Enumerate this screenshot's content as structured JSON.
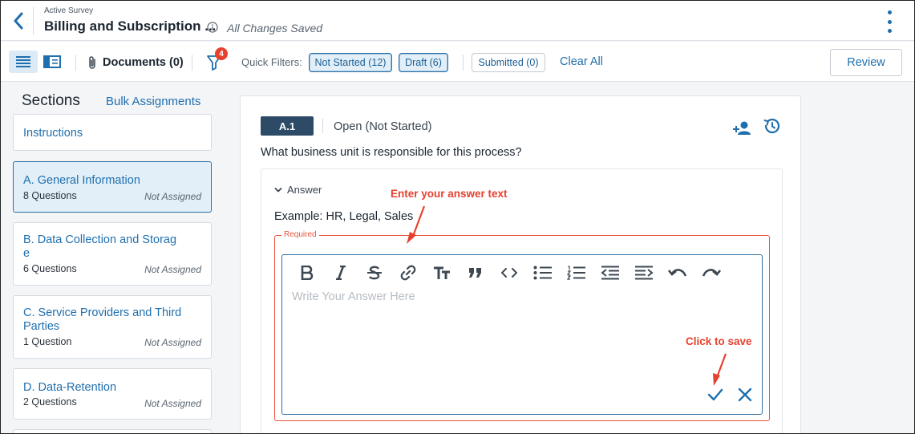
{
  "header": {
    "kicker": "Active Survey",
    "title": "Billing and Subscription ...",
    "save_status": "All Changes Saved"
  },
  "toolbar": {
    "documents_label": "Documents (0)",
    "filter_count": "4",
    "quick_filters_label": "Quick Filters:",
    "chips": [
      {
        "label": "Not Started (12)",
        "active": true
      },
      {
        "label": "Draft (6)",
        "active": true
      },
      {
        "label": "Submitted (0)",
        "active": false
      }
    ],
    "clear_all": "Clear All",
    "review": "Review"
  },
  "sidebar": {
    "title": "Sections",
    "bulk_link": "Bulk Assignments",
    "instructions": "Instructions",
    "sections": [
      {
        "name": "A. General Information",
        "count": "8 Questions",
        "assign": "Not Assigned",
        "selected": true
      },
      {
        "name": "B. Data Collection and Storag\ne",
        "count": "6 Questions",
        "assign": "Not Assigned",
        "selected": false
      },
      {
        "name": "C. Service Providers and Third\nParties",
        "count": "1 Question",
        "assign": "Not Assigned",
        "selected": false
      },
      {
        "name": "D. Data-Retention",
        "count": "2 Questions",
        "assign": "Not Assigned",
        "selected": false
      }
    ]
  },
  "question": {
    "id": "A.1",
    "status": "Open (Not Started)",
    "text": "What business unit is responsible for this process?",
    "answer_label": "Answer",
    "example": "Example: HR, Legal, Sales",
    "required_label": "Required",
    "placeholder": "Write Your Answer Here",
    "answer_value": ""
  },
  "annotations": {
    "enter_text": "Enter your answer text",
    "click_save": "Click to save"
  },
  "colors": {
    "accent": "#1f6fae",
    "annotation": "#e8402e",
    "id_badge": "#2d4a66"
  }
}
